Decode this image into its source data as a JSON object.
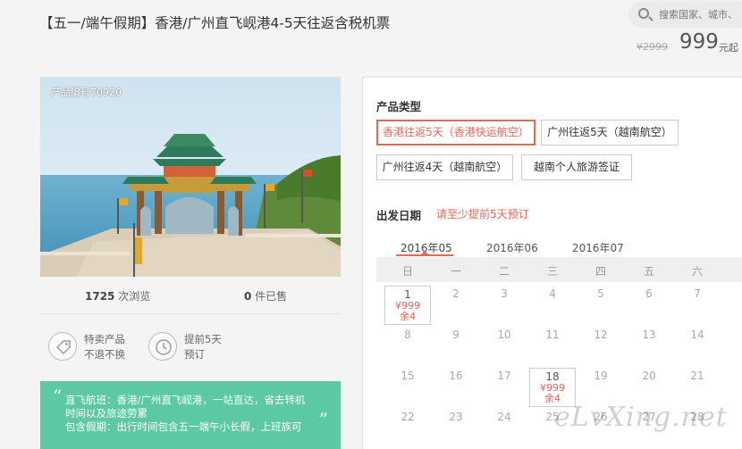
{
  "product": {
    "title": "【五一/端午假期】香港/广州直飞岘港4-5天往返含税机票",
    "original_price": "¥2999",
    "price": "999",
    "price_unit": "元起",
    "product_no": "产品编号70920"
  },
  "search": {
    "placeholder": "搜索国家、城市、"
  },
  "stats": {
    "views": "1725",
    "views_label": " 次浏览",
    "sold": "0",
    "sold_label": " 件已售"
  },
  "features": [
    {
      "line1": "特卖产品",
      "line2": "不退不换",
      "icon": "tag-icon"
    },
    {
      "line1": "提前5天",
      "line2": "预订",
      "icon": "clock-icon"
    }
  ],
  "quote": {
    "open": "“",
    "close": "”",
    "line1": "直飞航班：香港/广州直飞岘港，一站直达，省去转机",
    "line2": "时间以及旅途劳累",
    "line3": "包含假期：出行时间包含五一端午小长假，上班族可"
  },
  "booking": {
    "product_type_label": "产品类型",
    "options": [
      "香港往返5天（香港快运航空）",
      "广州往返5天（越南航空）",
      "广州往返4天（越南航空）",
      "越南个人旅游签证"
    ],
    "date_label": "出发日期",
    "date_hint": "请至少提前5天预订"
  },
  "calendar": {
    "months": [
      "2016年05",
      "2016年06",
      "2016年07"
    ],
    "weekdays": [
      "日",
      "一",
      "二",
      "三",
      "四",
      "五",
      "六"
    ],
    "rows": [
      [
        "1",
        "2",
        "3",
        "4",
        "5",
        "6",
        "7"
      ],
      [
        "8",
        "9",
        "10",
        "11",
        "12",
        "13",
        "14"
      ],
      [
        "15",
        "16",
        "17",
        "18",
        "19",
        "20",
        "21"
      ],
      [
        "22",
        "23",
        "24",
        "25",
        "26",
        "27",
        "28"
      ]
    ],
    "available": [
      {
        "day": "1",
        "price": "¥999",
        "stock": "余4"
      },
      {
        "day": "18",
        "price": "¥999",
        "stock": "余4"
      }
    ]
  },
  "watermark": "eLvXing.net",
  "colors": {
    "accent": "#e06a5a",
    "quote_bg": "#5cc8a4"
  }
}
